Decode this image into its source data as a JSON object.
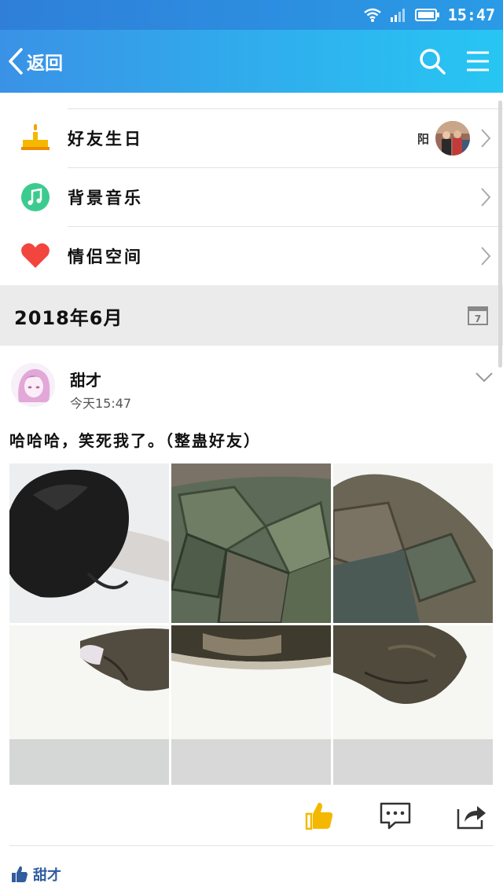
{
  "status_bar": {
    "time": "15:47"
  },
  "nav": {
    "back_label": "返回"
  },
  "menu": {
    "items": [
      {
        "label": "好友生日",
        "extra_name": "阳"
      },
      {
        "label": "背景音乐"
      },
      {
        "label": "情侣空间"
      }
    ]
  },
  "date_header": {
    "label": "2018年6月",
    "calendar_day": "7"
  },
  "post": {
    "author": "甜才",
    "time": "今天15:47",
    "text": "哈哈哈，笑死我了。（整蛊好友）",
    "likes_name": "甜才"
  },
  "colors": {
    "nav_gradient_start": "#3a92e6",
    "nav_gradient_end": "#27c6f3",
    "like_color": "#f5b800",
    "music_color": "#3ccb8e",
    "heart_color": "#f2453d"
  }
}
